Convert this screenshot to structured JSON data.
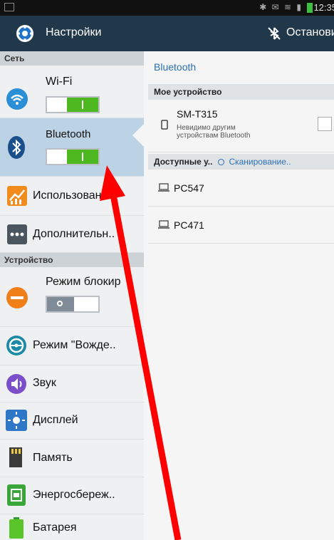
{
  "status_bar": {
    "time": "12:35"
  },
  "action_bar": {
    "title": "Настройки",
    "stop_label": "Остановить"
  },
  "sidebar": {
    "sections": [
      {
        "label": "Сеть"
      },
      {
        "label": "Устройство"
      }
    ],
    "items": [
      {
        "label": "Wi-Fi",
        "icon": "wifi-icon",
        "toggle": "on"
      },
      {
        "label": "Bluetooth",
        "icon": "bluetooth-icon",
        "toggle": "on",
        "selected": true
      },
      {
        "label": "Использовани..",
        "icon": "data-usage-icon"
      },
      {
        "label": "Дополнительн..",
        "icon": "more-icon"
      },
      {
        "label": "Режим блокир",
        "icon": "block-mode-icon",
        "toggle": "off"
      },
      {
        "label": "Режим \"Вожде..",
        "icon": "driving-mode-icon"
      },
      {
        "label": "Звук",
        "icon": "sound-icon"
      },
      {
        "label": "Дисплей",
        "icon": "display-icon"
      },
      {
        "label": "Память",
        "icon": "storage-icon"
      },
      {
        "label": "Энергосбереж..",
        "icon": "power-saving-icon"
      },
      {
        "label": "Батарея",
        "icon": "battery-icon"
      }
    ]
  },
  "detail": {
    "title": "Bluetooth",
    "my_device_header": "Мое устройство",
    "my_device": {
      "name": "SM-T315",
      "subtitle_line1": "Невидимо другим",
      "subtitle_line2": "устройствам Bluetooth"
    },
    "available_header": "Доступные у..",
    "scanning_label": "Сканирование..",
    "devices": [
      {
        "name": "PC547",
        "icon": "laptop-icon"
      },
      {
        "name": "PC471",
        "icon": "laptop-icon"
      }
    ]
  },
  "colors": {
    "action_bar": "#21374a",
    "selected_item": "#bcd3e6",
    "toggle_on": "#4db81f",
    "accent_text": "#2b6fb3",
    "annotation_arrow": "#ff0000"
  }
}
